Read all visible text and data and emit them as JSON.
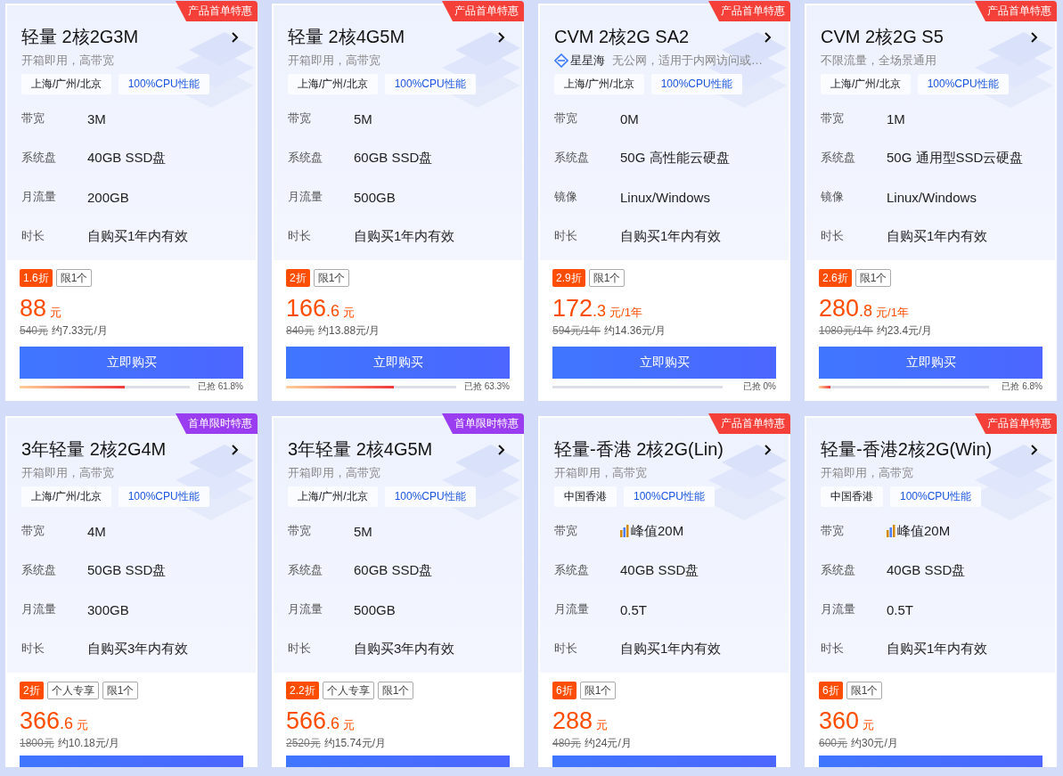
{
  "cards": [
    {
      "ribbon": {
        "kind": "product",
        "label": "产品首单特惠"
      },
      "title": "轻量 2核2G3M",
      "subtitle": {
        "text": "开箱即用，高带宽"
      },
      "tags": [
        {
          "kind": "region",
          "label": "上海/广州/北京"
        },
        {
          "kind": "feature",
          "label": "100%CPU性能"
        }
      ],
      "specs": [
        {
          "label": "带宽",
          "value": "3M"
        },
        {
          "label": "系统盘",
          "value": "40GB SSD盘"
        },
        {
          "label": "月流量",
          "value": "200GB"
        },
        {
          "label": "时长",
          "value": "自购买1年内有效"
        }
      ],
      "badges": [
        {
          "kind": "discount",
          "label": "1.6折"
        },
        {
          "kind": "limit",
          "label": "限1个"
        }
      ],
      "price": {
        "integer": "88",
        "unit": "元"
      },
      "original_price": "540元",
      "monthly": "约7.33元/月",
      "buy_button": {
        "label": "立即购买"
      },
      "progress": {
        "level": 0.618,
        "label": "已抢 61.8%"
      }
    },
    {
      "ribbon": {
        "kind": "product",
        "label": "产品首单特惠"
      },
      "title": "轻量 2核4G5M",
      "subtitle": {
        "text": "开箱即用，高带宽"
      },
      "tags": [
        {
          "kind": "region",
          "label": "上海/广州/北京"
        },
        {
          "kind": "feature",
          "label": "100%CPU性能"
        }
      ],
      "specs": [
        {
          "label": "带宽",
          "value": "5M"
        },
        {
          "label": "系统盘",
          "value": "60GB SSD盘"
        },
        {
          "label": "月流量",
          "value": "500GB"
        },
        {
          "label": "时长",
          "value": "自购买1年内有效"
        }
      ],
      "badges": [
        {
          "kind": "discount",
          "label": "2折"
        },
        {
          "kind": "limit",
          "label": "限1个"
        }
      ],
      "price": {
        "integer": "166",
        "decimal": ".6",
        "unit": "元"
      },
      "original_price": "840元",
      "monthly": "约13.88元/月",
      "buy_button": {
        "label": "立即购买"
      },
      "progress": {
        "level": 0.633,
        "label": "已抢 63.3%"
      }
    },
    {
      "ribbon": {
        "kind": "product",
        "label": "产品首单特惠"
      },
      "title": "CVM 2核2G SA2",
      "subtitle": {
        "brand": "星星海",
        "text": "无公网，适用于内网访问或…"
      },
      "tags": [
        {
          "kind": "region",
          "label": "上海/广州/北京"
        },
        {
          "kind": "feature",
          "label": "100%CPU性能"
        }
      ],
      "specs": [
        {
          "label": "带宽",
          "value": "0M"
        },
        {
          "label": "系统盘",
          "value": "50G 高性能云硬盘"
        },
        {
          "label": "镜像",
          "value": "Linux/Windows"
        },
        {
          "label": "时长",
          "value": "自购买1年内有效"
        }
      ],
      "badges": [
        {
          "kind": "discount",
          "label": "2.9折"
        },
        {
          "kind": "limit",
          "label": "限1个"
        }
      ],
      "price": {
        "integer": "172",
        "decimal": ".3",
        "unit": "元/1年"
      },
      "original_price": "594元/1年",
      "monthly": "约14.36元/月",
      "buy_button": {
        "label": "立即购买"
      },
      "progress": {
        "level": 0,
        "label": "已抢 0%"
      }
    },
    {
      "ribbon": {
        "kind": "product",
        "label": "产品首单特惠"
      },
      "title": "CVM 2核2G S5",
      "subtitle": {
        "text": "不限流量，全场景通用"
      },
      "tags": [
        {
          "kind": "region",
          "label": "上海/广州/北京"
        },
        {
          "kind": "feature",
          "label": "100%CPU性能"
        }
      ],
      "specs": [
        {
          "label": "带宽",
          "value": "1M"
        },
        {
          "label": "系统盘",
          "value": "50G 通用型SSD云硬盘"
        },
        {
          "label": "镜像",
          "value": "Linux/Windows"
        },
        {
          "label": "时长",
          "value": "自购买1年内有效"
        }
      ],
      "badges": [
        {
          "kind": "discount",
          "label": "2.6折"
        },
        {
          "kind": "limit",
          "label": "限1个"
        }
      ],
      "price": {
        "integer": "280",
        "decimal": ".8",
        "unit": "元/1年"
      },
      "original_price": "1080元/1年",
      "monthly": "约23.4元/月",
      "buy_button": {
        "label": "立即购买"
      },
      "progress": {
        "level": 0.068,
        "label": "已抢 6.8%"
      }
    },
    {
      "ribbon": {
        "kind": "limited",
        "label": "首单限时特惠"
      },
      "title": "3年轻量 2核2G4M",
      "subtitle": {
        "text": "开箱即用，高带宽"
      },
      "tags": [
        {
          "kind": "region",
          "label": "上海/广州/北京"
        },
        {
          "kind": "feature",
          "label": "100%CPU性能"
        }
      ],
      "specs": [
        {
          "label": "带宽",
          "value": "4M"
        },
        {
          "label": "系统盘",
          "value": "50GB SSD盘"
        },
        {
          "label": "月流量",
          "value": "300GB"
        },
        {
          "label": "时长",
          "value": "自购买3年内有效"
        }
      ],
      "badges": [
        {
          "kind": "discount",
          "label": "2折"
        },
        {
          "kind": "limit",
          "label": "个人专享"
        },
        {
          "kind": "limit",
          "label": "限1个"
        }
      ],
      "price": {
        "integer": "366",
        "decimal": ".6",
        "unit": "元"
      },
      "original_price": "1800元",
      "monthly": "约10.18元/月",
      "buy_button": {
        "cut_off": true
      }
    },
    {
      "ribbon": {
        "kind": "limited",
        "label": "首单限时特惠"
      },
      "title": "3年轻量 2核4G5M",
      "subtitle": {
        "text": "开箱即用，高带宽"
      },
      "tags": [
        {
          "kind": "region",
          "label": "上海/广州/北京"
        },
        {
          "kind": "feature",
          "label": "100%CPU性能"
        }
      ],
      "specs": [
        {
          "label": "带宽",
          "value": "5M"
        },
        {
          "label": "系统盘",
          "value": "60GB SSD盘"
        },
        {
          "label": "月流量",
          "value": "500GB"
        },
        {
          "label": "时长",
          "value": "自购买3年内有效"
        }
      ],
      "badges": [
        {
          "kind": "discount",
          "label": "2.2折"
        },
        {
          "kind": "limit",
          "label": "个人专享"
        },
        {
          "kind": "limit",
          "label": "限1个"
        }
      ],
      "price": {
        "integer": "566",
        "decimal": ".6",
        "unit": "元"
      },
      "original_price": "2520元",
      "monthly": "约15.74元/月",
      "buy_button": {
        "cut_off": true
      }
    },
    {
      "ribbon": {
        "kind": "product",
        "label": "产品首单特惠"
      },
      "title": "轻量-香港 2核2G(Lin)",
      "subtitle": {
        "text": "开箱即用，高带宽"
      },
      "tags": [
        {
          "kind": "region",
          "label": "中国香港"
        },
        {
          "kind": "feature",
          "label": "100%CPU性能"
        }
      ],
      "specs": [
        {
          "label": "带宽",
          "value": "峰值20M",
          "peak_icon": true
        },
        {
          "label": "系统盘",
          "value": "40GB SSD盘"
        },
        {
          "label": "月流量",
          "value": "0.5T"
        },
        {
          "label": "时长",
          "value": "自购买1年内有效"
        }
      ],
      "badges": [
        {
          "kind": "discount",
          "label": "6折"
        },
        {
          "kind": "limit",
          "label": "限1个"
        }
      ],
      "price": {
        "integer": "288",
        "unit": "元"
      },
      "original_price": "480元",
      "monthly": "约24元/月",
      "buy_button": {
        "cut_off": true
      }
    },
    {
      "ribbon": {
        "kind": "product",
        "label": "产品首单特惠"
      },
      "title": "轻量-香港2核2G(Win)",
      "subtitle": {
        "text": "开箱即用，高带宽"
      },
      "tags": [
        {
          "kind": "region",
          "label": "中国香港"
        },
        {
          "kind": "feature",
          "label": "100%CPU性能"
        }
      ],
      "specs": [
        {
          "label": "带宽",
          "value": "峰值20M",
          "peak_icon": true
        },
        {
          "label": "系统盘",
          "value": "40GB SSD盘"
        },
        {
          "label": "月流量",
          "value": "0.5T"
        },
        {
          "label": "时长",
          "value": "自购买1年内有效"
        }
      ],
      "badges": [
        {
          "kind": "discount",
          "label": "6折"
        },
        {
          "kind": "limit",
          "label": "限1个"
        }
      ],
      "price": {
        "integer": "360",
        "unit": "元"
      },
      "original_price": "600元",
      "monthly": "约30元/月",
      "buy_button": {
        "cut_off": true
      }
    }
  ]
}
